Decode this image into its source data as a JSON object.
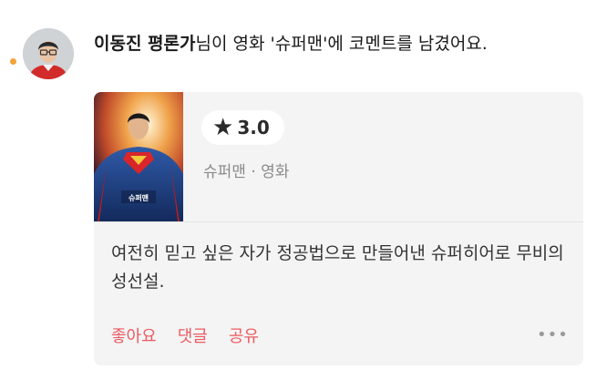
{
  "notification": {
    "author": "이동진 평론가",
    "message": "님이 영화 '슈퍼맨'에 코멘트를 남겼어요."
  },
  "card": {
    "poster_title": "슈퍼맨",
    "rating": {
      "icon": "star-icon",
      "value": "3.0"
    },
    "meta": "슈퍼맨 · 영화",
    "comment": "여전히 믿고 싶은 자가 정공법으로 만들어낸 슈퍼히어로 무비의 성선설.",
    "actions": {
      "like": "좋아요",
      "reply": "댓글",
      "share": "공유"
    },
    "more_icon": "more-dots-icon"
  },
  "colors": {
    "accent": "#ec5b62",
    "unread_dot": "#f2a33a",
    "card_bg": "#f4f4f4",
    "meta_text": "#8a8a8a"
  }
}
